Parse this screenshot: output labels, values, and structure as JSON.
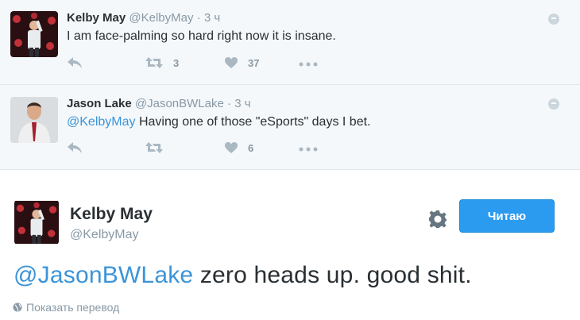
{
  "reply1": {
    "name": "Kelby May",
    "handle": "@KelbyMay",
    "time": "3 ч",
    "text": "I am face-palming so hard right now it is insane.",
    "retweets": "3",
    "likes": "37"
  },
  "reply2": {
    "name": "Jason Lake",
    "handle": "@JasonBWLake",
    "time": "3 ч",
    "mention": "@KelbyMay",
    "text": " Having one of those \"eSports\" days I bet.",
    "retweets": "",
    "likes": "6"
  },
  "main": {
    "name": "Kelby May",
    "handle": "@KelbyMay",
    "follow_label": "Читаю",
    "mention": "@JasonBWLake",
    "text": " zero heads up. good shit.",
    "translate_label": "Показать перевод"
  },
  "colors": {
    "link": "#3b94d9",
    "follow_button": "#2b9bf0",
    "reply_background": "#f5f8fa",
    "action_icons": "#aab8c2"
  }
}
